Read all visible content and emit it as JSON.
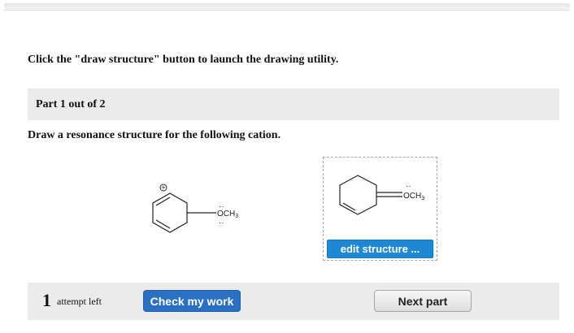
{
  "instruction": "Click the \"draw structure\" button to launch the drawing utility.",
  "part": {
    "label": "Part 1 out of 2"
  },
  "question": "Draw a resonance structure for the following cation.",
  "given_molecule": {
    "charge_label": "+",
    "substituent": "OCH",
    "substituent_subscript": "3",
    "lone_pair_top": "··",
    "lone_pair_bottom": "··"
  },
  "answer": {
    "lone_pair": "··",
    "substituent": "OCH",
    "substituent_subscript": "3",
    "edit_button": "edit structure ..."
  },
  "footer": {
    "attempts_count": "1",
    "attempts_text": "attempt left",
    "check_button": "Check my work",
    "next_button": "Next part"
  }
}
